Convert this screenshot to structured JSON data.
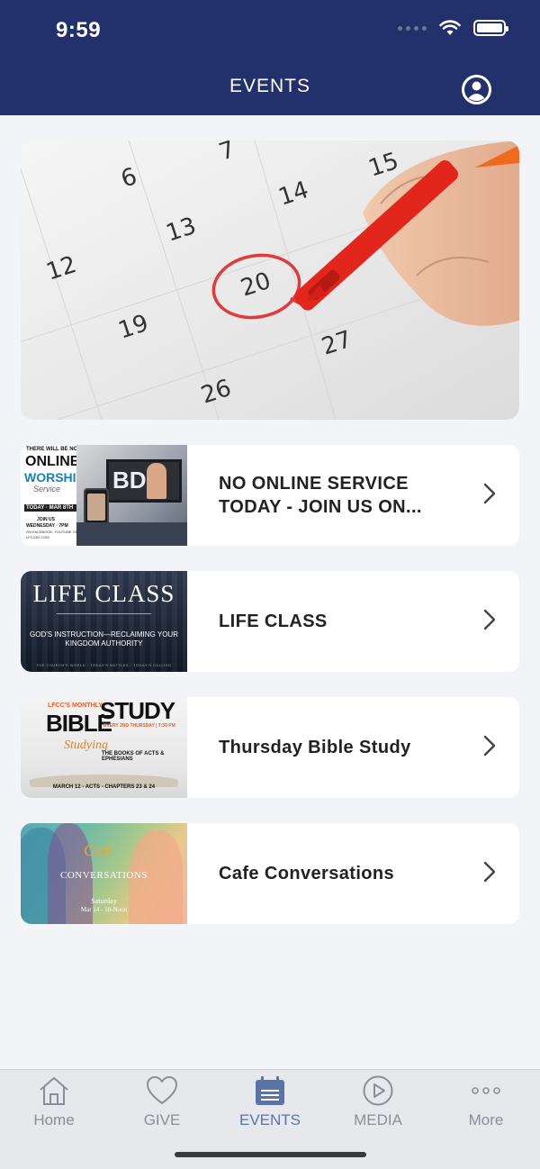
{
  "status_bar": {
    "time": "9:59"
  },
  "header": {
    "title": "EVENTS"
  },
  "events": [
    {
      "label": "NO ONLINE SERVICE TODAY - JOIN US ON...",
      "thumb": {
        "l1": "THERE WILL BE NO",
        "l2": "ONLINE",
        "l3": "WORSHIP",
        "l4": "Service",
        "l5": "TODAY · MAR 8TH",
        "l6": "JOIN US",
        "l7": "WEDNESDAY · 7PM",
        "l8": "ON FACEBOOK, YOUTUBE OR",
        "l9": "LFCCBJ.COM",
        "screen": "BD"
      }
    },
    {
      "label": "LIFE CLASS",
      "thumb": {
        "l1": "LIFE CLASS",
        "l2": "GOD'S INSTRUCTION—RECLAIMING YOUR",
        "l3": "KINGDOM AUTHORITY",
        "l4": "THE CHURCH'S WORLD · TODAY'S BATTLES · TODAY'S CALLING"
      }
    },
    {
      "label": "Thursday Bible Study",
      "thumb": {
        "l1": "LFCC'S MONTHLY",
        "l2": "BIBLE",
        "l3": "STUDY",
        "l4": "EVERY 2ND THURSDAY | 7:30 PM",
        "l5": "Studying",
        "l6": "THE BOOKS OF ACTS & EPHESIANS",
        "l7": "MARCH 12 - ACTS - CHAPTERS 23 & 24"
      }
    },
    {
      "label": "Cafe Conversations",
      "thumb": {
        "l1": "Cafe",
        "l2": "CONVERSATIONS",
        "l3": "Saturday",
        "l4": "Mar 14 - 10-Noon"
      }
    }
  ],
  "hero_calendar": {
    "dates": [
      "7",
      "6",
      "15",
      "14",
      "13",
      "12",
      "20",
      "19",
      "27",
      "26"
    ]
  },
  "tabs": [
    {
      "label": "Home",
      "icon": "home-icon"
    },
    {
      "label": "GIVE",
      "icon": "heart-icon"
    },
    {
      "label": "EVENTS",
      "icon": "calendar-icon",
      "active": true
    },
    {
      "label": "MEDIA",
      "icon": "play-icon"
    },
    {
      "label": "More",
      "icon": "more-icon"
    }
  ],
  "colors": {
    "header": "#22306b",
    "active_tab": "#5c73a6",
    "inactive_tab": "#8b8e96",
    "background": "#f3f4f8"
  }
}
